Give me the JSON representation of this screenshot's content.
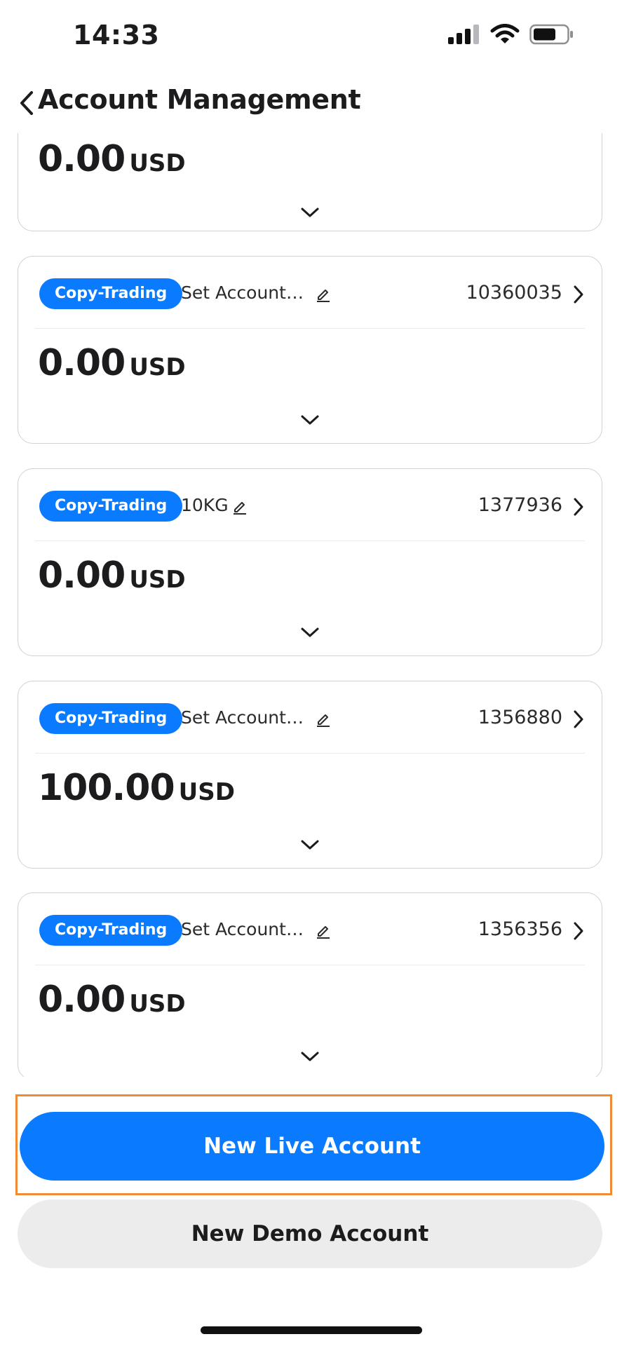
{
  "status_bar": {
    "time": "14:33",
    "icons": [
      "cellular-signal-icon",
      "wifi-icon",
      "battery-icon"
    ]
  },
  "header": {
    "title": "Account Management",
    "back_icon": "chevron-left-icon"
  },
  "partial_card": {
    "amount": "0.00",
    "currency": "USD"
  },
  "accounts": [
    {
      "type_badge": "Copy-Trading",
      "name": "Set Account…",
      "number": "10360035",
      "amount": "0.00",
      "currency": "USD"
    },
    {
      "type_badge": "Copy-Trading",
      "name": "10KG",
      "number": "1377936",
      "amount": "0.00",
      "currency": "USD"
    },
    {
      "type_badge": "Copy-Trading",
      "name": "Set Account…",
      "number": "1356880",
      "amount": "100.00",
      "currency": "USD"
    },
    {
      "type_badge": "Copy-Trading",
      "name": "Set Account…",
      "number": "1356356",
      "amount": "0.00",
      "currency": "USD"
    }
  ],
  "actions": {
    "new_live": "New Live Account",
    "new_demo": "New Demo Account"
  },
  "colors": {
    "accent": "#0a7aff",
    "highlight_border": "#f08a34",
    "secondary_button": "#ececec"
  }
}
